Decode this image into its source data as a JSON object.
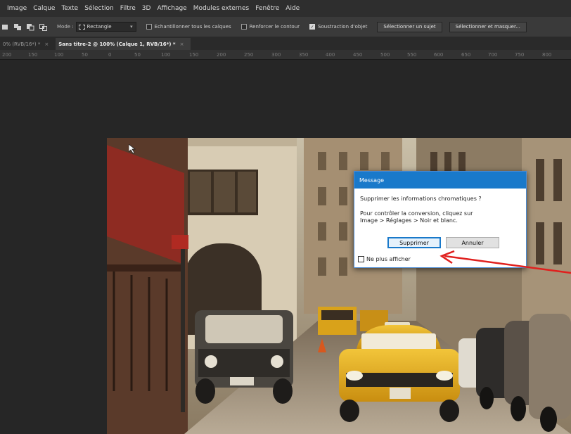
{
  "menu": {
    "items": [
      "Image",
      "Calque",
      "Texte",
      "Sélection",
      "Filtre",
      "3D",
      "Affichage",
      "Modules externes",
      "Fenêtre",
      "Aide"
    ]
  },
  "options": {
    "mode_label": "Mode :",
    "mode_value": "Rectangle",
    "sample_all_layers": "Echantillonner tous les calques",
    "enhance_edge": "Renforcer le contour",
    "object_subtract": "Soustraction d'objet",
    "select_subject": "Sélectionner un sujet",
    "select_and_mask": "Sélectionner et masquer..."
  },
  "tabs": {
    "tab1": "0% (RVB/16*) *",
    "tab2": "Sans titre-2 @ 100% (Calque 1, RVB/16*) *",
    "close": "×"
  },
  "ruler": {
    "ticks": [
      "200",
      "150",
      "100",
      "50",
      "0",
      "50",
      "100",
      "150",
      "200",
      "250",
      "300",
      "350",
      "400",
      "450",
      "500",
      "550",
      "600",
      "650",
      "700",
      "750",
      "800"
    ]
  },
  "dialog": {
    "title": "Message",
    "question": "Supprimer les informations chromatiques ?",
    "info_line1": "Pour contrôler la conversion, cliquez sur",
    "info_line2": "Image > Réglages > Noir et blanc.",
    "primary_button": "Supprimer",
    "secondary_button": "Annuler",
    "dont_show": "Ne plus afficher"
  },
  "colors": {
    "dialog_title_bar": "#1979ca",
    "annotation_arrow": "#e0201e",
    "taxi_yellow": "#e8b21a"
  }
}
